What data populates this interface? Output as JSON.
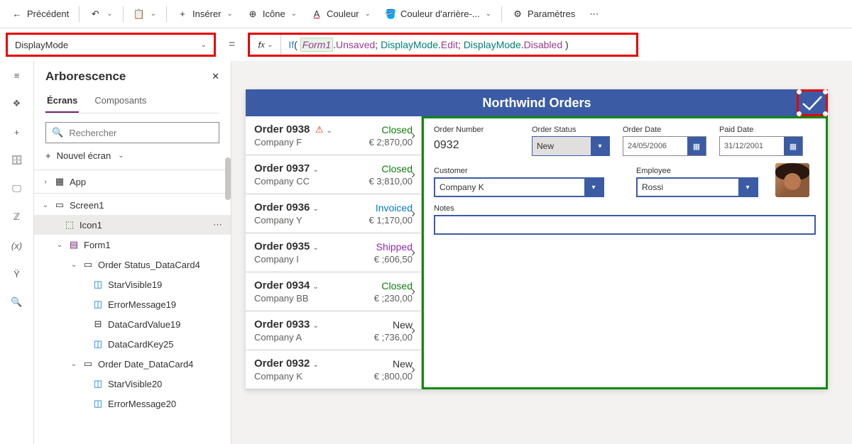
{
  "toolbar": {
    "back": "Précédent",
    "insert": "Insérer",
    "icon": "Icône",
    "color": "Couleur",
    "bgcolor": "Couleur d'arrière-...",
    "settings": "Paramètres"
  },
  "property_dropdown": "DisplayMode",
  "formula_tokens": {
    "fn": "If",
    "obj": "Form1",
    "unsaved": "Unsaved",
    "dm": "DisplayMode",
    "edit": "Edit",
    "disabled": "Disabled"
  },
  "tree": {
    "title": "Arborescence",
    "tab_screens": "Écrans",
    "tab_components": "Composants",
    "search_placeholder": "Rechercher",
    "new_screen": "Nouvel écran",
    "nodes": {
      "app": "App",
      "screen1": "Screen1",
      "icon1": "Icon1",
      "form1": "Form1",
      "orderstatus": "Order Status_DataCard4",
      "starvisible19": "StarVisible19",
      "errormsg19": "ErrorMessage19",
      "datacardvalue19": "DataCardValue19",
      "datacardkey25": "DataCardKey25",
      "orderdate": "Order Date_DataCard4",
      "starvisible20": "StarVisible20",
      "errormsg20": "ErrorMessage20"
    }
  },
  "app": {
    "title": "Northwind Orders",
    "orders": [
      {
        "id": "Order 0938",
        "warn": true,
        "status": "Closed",
        "status_cls": "st-closed",
        "company": "Company F",
        "amount": "€ 2;870,00"
      },
      {
        "id": "Order 0937",
        "status": "Closed",
        "status_cls": "st-closed",
        "company": "Company CC",
        "amount": "€ 3;810,00"
      },
      {
        "id": "Order 0936",
        "status": "Invoiced",
        "status_cls": "st-invoiced",
        "company": "Company Y",
        "amount": "€ 1;170,00"
      },
      {
        "id": "Order 0935",
        "status": "Shipped",
        "status_cls": "st-shipped",
        "company": "Company I",
        "amount": "€ ;606,50"
      },
      {
        "id": "Order 0934",
        "status": "Closed",
        "status_cls": "st-closed",
        "company": "Company BB",
        "amount": "€ ;230,00"
      },
      {
        "id": "Order 0933",
        "status": "New",
        "status_cls": "st-new",
        "company": "Company A",
        "amount": "€ ;736,00"
      },
      {
        "id": "Order 0932",
        "status": "New",
        "status_cls": "st-new",
        "company": "Company K",
        "amount": "€ ;800,00"
      }
    ],
    "form": {
      "order_number_label": "Order Number",
      "order_number_value": "0932",
      "order_status_label": "Order Status",
      "order_status_value": "New",
      "order_date_label": "Order Date",
      "order_date_value": "24/05/2006",
      "paid_date_label": "Paid Date",
      "paid_date_value": "31/12/2001",
      "customer_label": "Customer",
      "customer_value": "Company K",
      "employee_label": "Employee",
      "employee_value": "Rossi",
      "notes_label": "Notes"
    }
  }
}
